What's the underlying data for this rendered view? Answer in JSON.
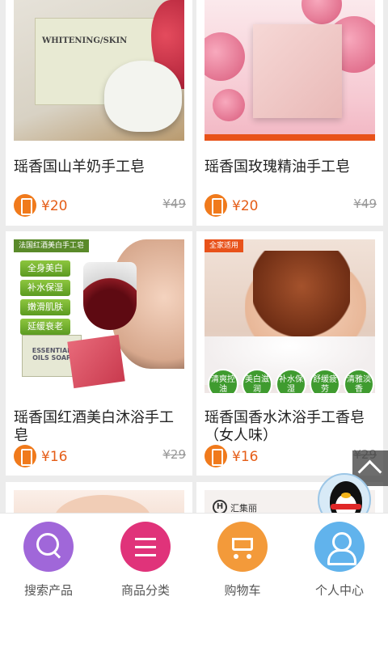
{
  "products": [
    {
      "title": "瑶香国山羊奶手工皂",
      "price": "¥20",
      "orig_price": "¥49",
      "image_text": "WHITENING/SKIN"
    },
    {
      "title": "瑶香国玫瑰精油手工皂",
      "price": "¥20",
      "orig_price": "¥49"
    },
    {
      "title": "瑶香国红酒美白沐浴手工皂",
      "price": "¥16",
      "orig_price": "¥29",
      "image_label": "法国红酒美白手工皂",
      "image_tags": [
        "全身美白",
        "补水保湿",
        "嫩滑肌肤",
        "延缓衰老"
      ],
      "image_box_text": "ESSENTIAL OILS SOAP"
    },
    {
      "title": "瑶香国香水沐浴手工香皂（女人味）",
      "price": "¥16",
      "orig_price": "¥29",
      "image_label": "全家适用",
      "image_badges": [
        "清爽控油",
        "美白滋润",
        "补水保湿",
        "舒缓疲劳",
        "清雅淡香"
      ]
    },
    {
      "brand_text": "汇集丽"
    }
  ],
  "nav": [
    {
      "label": "搜索产品",
      "icon": "search-icon",
      "color": "#a067d9"
    },
    {
      "label": "商品分类",
      "icon": "list-icon",
      "color": "#e0337a"
    },
    {
      "label": "购物车",
      "icon": "cart-icon",
      "color": "#f39a3a"
    },
    {
      "label": "个人中心",
      "icon": "user-icon",
      "color": "#61b3ec"
    }
  ],
  "colors": {
    "price": "#e55d17",
    "accent": "#f07a1c"
  }
}
